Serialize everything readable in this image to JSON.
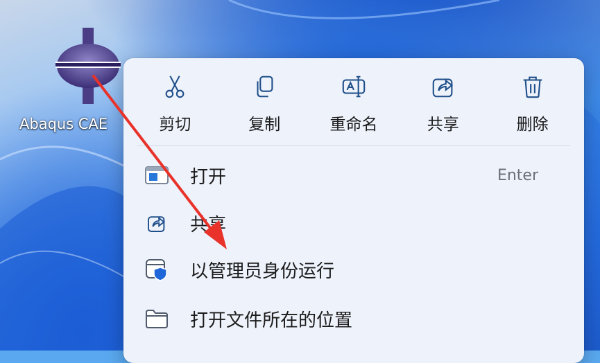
{
  "desktop": {
    "icon_label": "Abaqus CAE",
    "icon_name": "abaqus-cae-icon"
  },
  "context_menu": {
    "quick_actions": [
      {
        "label": "剪切",
        "icon": "scissors-icon"
      },
      {
        "label": "复制",
        "icon": "copy-icon"
      },
      {
        "label": "重命名",
        "icon": "rename-icon"
      },
      {
        "label": "共享",
        "icon": "share-icon"
      },
      {
        "label": "删除",
        "icon": "trash-icon"
      }
    ],
    "items": [
      {
        "label": "打开",
        "accelerator": "Enter",
        "icon": "open-app-icon"
      },
      {
        "label": "共享",
        "icon": "share-icon"
      },
      {
        "label": "以管理员身份运行",
        "icon": "run-as-admin-shield-icon"
      },
      {
        "label": "打开文件所在的位置",
        "icon": "folder-icon"
      }
    ]
  },
  "annotation": {
    "type": "red-arrow",
    "color": "#e8322a"
  }
}
